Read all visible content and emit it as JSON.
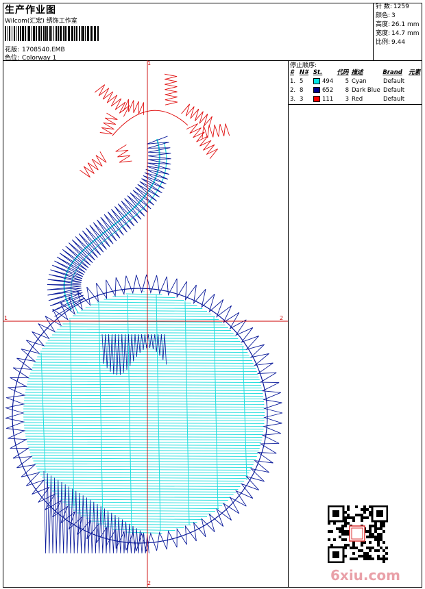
{
  "header": {
    "title": "生产作业图",
    "studio": "Wilcom(汇宏) 绣饰工作室",
    "design_label": "花版:",
    "design_value": "1708540.EMB",
    "colorway_label": "色位:",
    "colorway_value": "Colorway 1"
  },
  "stats": {
    "stitches_label": "针 数:",
    "stitches_value": "1259",
    "colors_label": "颜色:",
    "colors_value": "3",
    "height_label": "高度:",
    "height_value": "26.1 mm",
    "width_label": "宽度:",
    "width_value": "14.7 mm",
    "scale_label": "比例:",
    "scale_value": "9.44"
  },
  "axis_labels": {
    "top": "1",
    "bottom": "2",
    "left": "1",
    "right": "2"
  },
  "stop_sequence": {
    "title": "停止顺序:",
    "headers": [
      "#",
      "N#",
      "St.",
      "代码",
      "描述",
      "Brand",
      "元素"
    ],
    "rows": [
      {
        "num": "1.",
        "n": "5",
        "st": "494",
        "code": "5",
        "desc": "Cyan",
        "brand": "Default",
        "color": "#00e5e5"
      },
      {
        "num": "2.",
        "n": "8",
        "st": "652",
        "code": "8",
        "desc": "Dark Blue",
        "brand": "Default",
        "color": "#00008b"
      },
      {
        "num": "3.",
        "n": "3",
        "st": "111",
        "code": "3",
        "desc": "Red",
        "brand": "Default",
        "color": "#ff0000"
      }
    ]
  },
  "colors": {
    "cyan": "#22dddd",
    "dark_blue": "#0a1a9a",
    "red": "#e01010",
    "axis": "#cc0000"
  },
  "watermark": "6xiu.com"
}
